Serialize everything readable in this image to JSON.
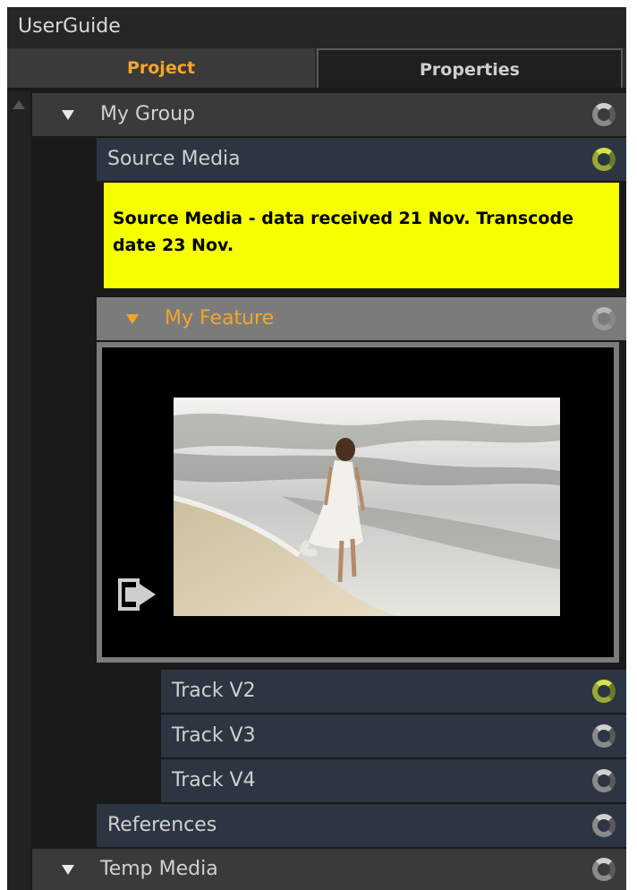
{
  "app": {
    "title": "UserGuide"
  },
  "tabs": [
    {
      "label": "Project",
      "active": true
    },
    {
      "label": "Properties",
      "active": false
    }
  ],
  "tree": {
    "group": {
      "label": "My Group",
      "status": "idle"
    },
    "source_media": {
      "label": "Source Media",
      "status": "active"
    },
    "note": {
      "text": "Source Media - data received 21 Nov. Transcode date 23 Nov.",
      "color": "#f5ff00"
    },
    "feature": {
      "label": "My Feature",
      "status": "idle"
    },
    "tracks": [
      {
        "label": "Track V2",
        "status": "active"
      },
      {
        "label": "Track V3",
        "status": "idle"
      },
      {
        "label": "Track V4",
        "status": "idle"
      }
    ],
    "references": {
      "label": "References",
      "status": "idle"
    },
    "temp_media": {
      "label": "Temp Media",
      "status": "idle"
    }
  },
  "colors": {
    "accent": "#f5a52a",
    "row_group": "#3a3a3a",
    "row_item": "#2c3541",
    "note_bg": "#f5ff00",
    "status_active": "#c8d23c"
  },
  "icons": {
    "expand": "triangle-down-icon",
    "status": "sync-spinner-icon",
    "thumbnail": "video-thumbnail",
    "export": "export-arrow-icon"
  }
}
